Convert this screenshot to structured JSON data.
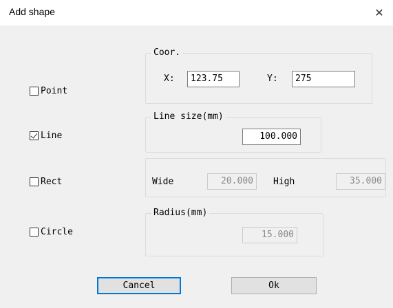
{
  "window": {
    "title": "Add shape",
    "close_glyph": "✕"
  },
  "options": {
    "point": {
      "label": "Point",
      "checked": false
    },
    "line": {
      "label": "Line",
      "checked": true
    },
    "rect": {
      "label": "Rect",
      "checked": false
    },
    "circle": {
      "label": "Circle",
      "checked": false
    }
  },
  "coor": {
    "legend": "Coor.",
    "x_label": "X:",
    "x_value": "123.75",
    "y_label": "Y:",
    "y_value": "275"
  },
  "line_size": {
    "legend": "Line size(mm)",
    "value": "100.000"
  },
  "rect": {
    "wide_label": "Wide",
    "wide_value": "20.000",
    "high_label": "High",
    "high_value": "35.000"
  },
  "radius": {
    "legend": "Radius(mm)",
    "value": "15.000"
  },
  "buttons": {
    "cancel": "Cancel",
    "ok": "Ok"
  },
  "colors": {
    "dialog_bg": "#f0f0f0",
    "focus_border": "#0078d7"
  },
  "icons": {
    "close": "close-icon",
    "checkmark": "checkmark-icon"
  }
}
